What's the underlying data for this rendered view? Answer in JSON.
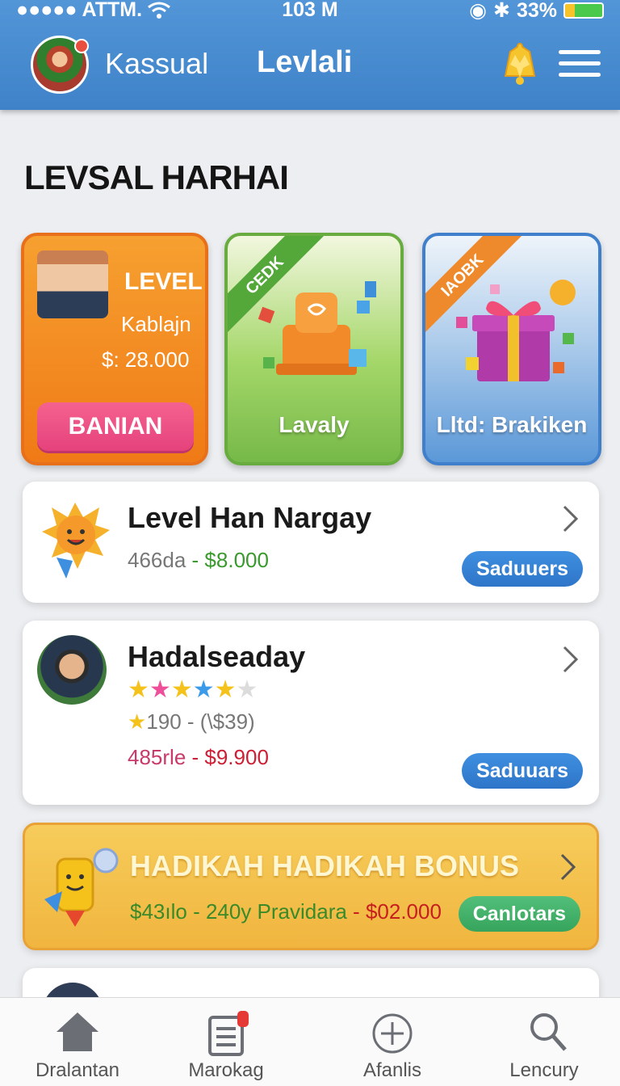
{
  "status_bar": {
    "carrier": "ATTM.",
    "time": "103 M",
    "battery": "33%"
  },
  "header": {
    "username": "Kassual",
    "title": "Levlali"
  },
  "section_title": "LEVSAL HARHAI",
  "promos": [
    {
      "level": "LEVEL",
      "name": "Kablajn",
      "price": "$: 28.000",
      "button": "BANIAN"
    },
    {
      "ribbon": "CEDK",
      "caption": "Lavaly"
    },
    {
      "ribbon": "IAOBK",
      "caption": "Lltd: Brakiken"
    }
  ],
  "cards": [
    {
      "title": "Level Han Nargay",
      "meta_left": "466da",
      "sep": " - ",
      "price": "$8.000",
      "button": "Saduuers"
    },
    {
      "title": "Hadalseaday",
      "rating_text": "190 - (\\$39)",
      "meta_left": "485rle",
      "sep": " - ",
      "price": "$9.900",
      "button": "Saduuars"
    },
    {
      "title": "HADIKAH HADIKAH BONUS",
      "meta_left": "$43ılo - 240y Pravidara",
      "sep": " - ",
      "price": "$02.000",
      "button": "Canlotars"
    }
  ],
  "bottom_nav": [
    {
      "label": "Dralantan",
      "icon": "home-icon"
    },
    {
      "label": "Marokag",
      "icon": "clipboard-icon"
    },
    {
      "label": "Afanlis",
      "icon": "plus-circle-icon"
    },
    {
      "label": "Lencury",
      "icon": "search-icon"
    }
  ],
  "colors": {
    "header": "#4a8fd4",
    "accent_orange": "#f07a16",
    "accent_pink": "#e5427c",
    "pill_blue": "#2e75c8",
    "pill_green": "#37a45c"
  }
}
